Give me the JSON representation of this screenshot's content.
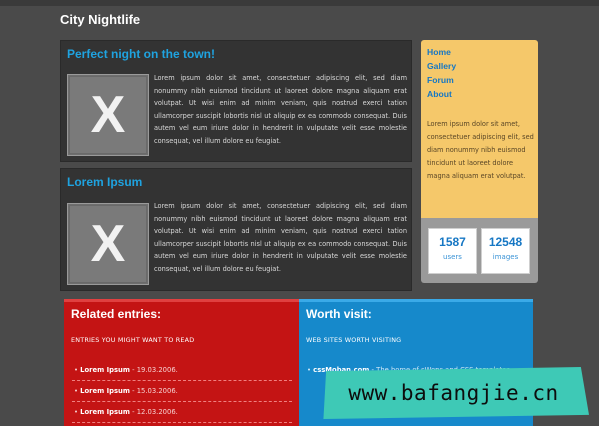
{
  "site": {
    "title": "City Nightlife"
  },
  "posts": [
    {
      "heading": "Perfect night on the town!",
      "thumb": "X",
      "body": "Lorem ipsum dolor sit amet, consectetuer adipiscing elit, sed diam nonummy nibh euismod tincidunt ut laoreet dolore magna aliquam erat volutpat. Ut wisi enim ad minim veniam, quis nostrud exerci tation ullamcorper suscipit lobortis nisl ut aliquip ex ea commodo consequat. Duis autem vel eum iriure dolor in hendrerit in vulputate velit esse molestie consequat, vel illum dolore eu feugiat."
    },
    {
      "heading": "Lorem Ipsum",
      "thumb": "X",
      "body": "Lorem ipsum dolor sit amet, consectetuer adipiscing elit, sed diam nonummy nibh euismod tincidunt ut laoreet dolore magna aliquam erat volutpat. Ut wisi enim ad minim veniam, quis nostrud exerci tation ullamcorper suscipit lobortis nisl ut aliquip ex ea commodo consequat. Duis autem vel eum iriure dolor in hendrerit in vulputate velit esse molestie consequat, vel illum dolore eu feugiat."
    }
  ],
  "nav": {
    "items": [
      "Home",
      "Gallery",
      "Forum",
      "About"
    ],
    "text": "Lorem ipsum dolor sit amet, consectetuer adipiscing elit, sed diam nonummy nibh euismod tincidunt ut laoreet dolore magna aliquam erat volutpat."
  },
  "stats": [
    {
      "value": "1587",
      "label": "users"
    },
    {
      "value": "12548",
      "label": "images"
    }
  ],
  "related": {
    "heading": "Related entries:",
    "subheading": "ENTRIES YOU MIGHT WANT TO READ",
    "entries": [
      {
        "title": "Lorem Ipsum",
        "date": " - 19.03.2006."
      },
      {
        "title": "Lorem Ipsum",
        "date": " - 15.03.2006."
      },
      {
        "title": "Lorem Ipsum",
        "date": " - 12.03.2006."
      }
    ]
  },
  "worth": {
    "heading": "Worth visit:",
    "subheading": "WEB SITES WORTH VISITING",
    "links": [
      {
        "title": "cssMoban.com",
        "desc": " - The home of sWeps and CSS templates"
      }
    ]
  },
  "watermark": "www.bafangjie.cn",
  "colors": {
    "accent": "#1fa3e0",
    "nav_bg": "#f5c86a",
    "red": "#c41414",
    "blue": "#1689cb"
  }
}
